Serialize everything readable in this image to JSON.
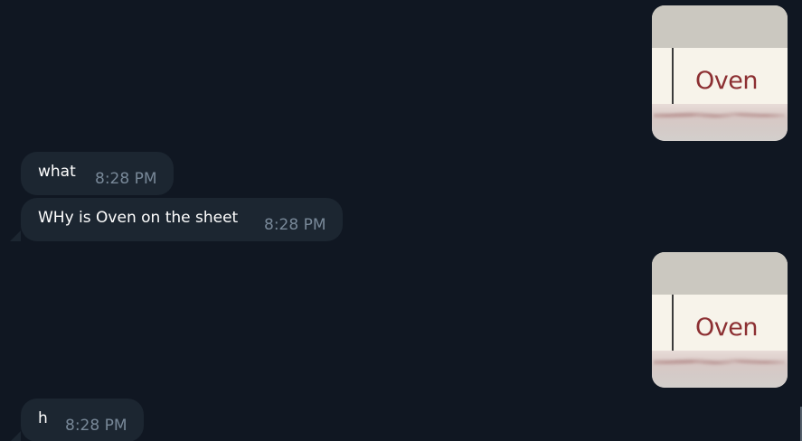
{
  "messages": [
    {
      "type": "image",
      "word": "Oven"
    },
    {
      "type": "text",
      "text": "what",
      "time": "8:28 PM"
    },
    {
      "type": "text",
      "text": "WHy is Oven on the sheet",
      "time": "8:28 PM"
    },
    {
      "type": "image",
      "word": "Oven"
    },
    {
      "type": "text",
      "text": "h",
      "time": "8:28 PM"
    }
  ],
  "colors": {
    "background": "#101722",
    "bubble": "#1c2631",
    "timestamp": "#788898",
    "oven_text": "#8c2f32"
  }
}
